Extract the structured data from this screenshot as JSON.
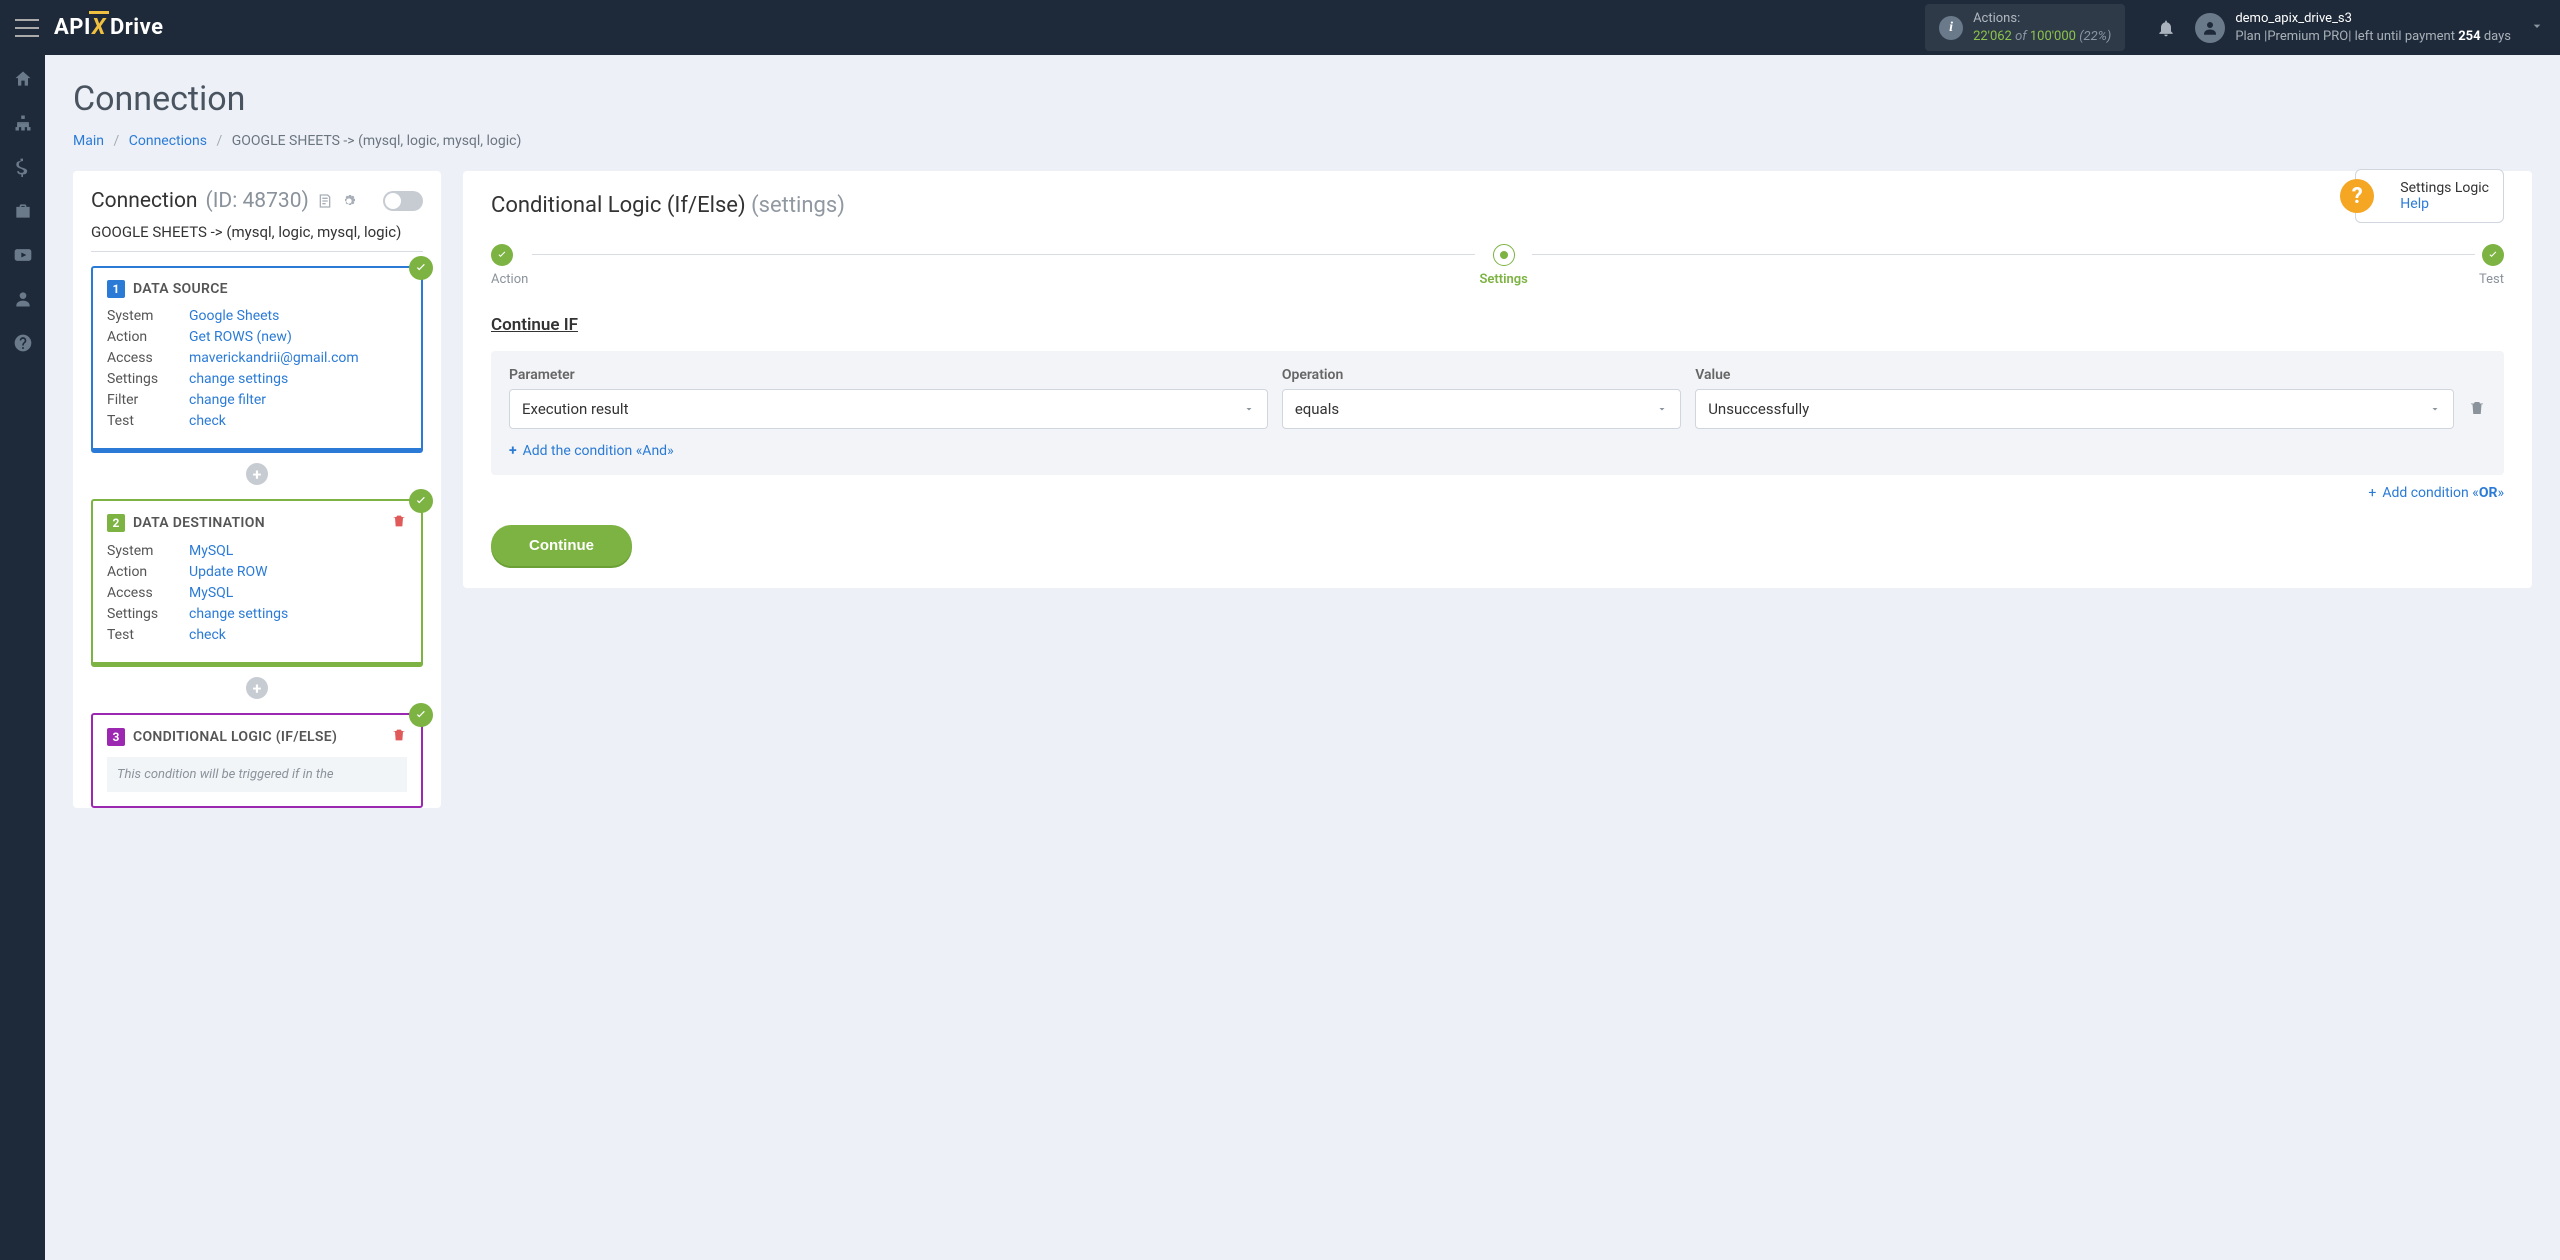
{
  "header": {
    "logo_parts": {
      "api": "API",
      "x": "X",
      "drive": "Drive"
    },
    "actions_label": "Actions:",
    "actions_used": "22'062",
    "actions_of": " of ",
    "actions_total": "100'000",
    "actions_pct": "(22%)",
    "user_name": "demo_apix_drive_s3",
    "plan_prefix": "Plan |",
    "plan_name": "Premium PRO",
    "plan_mid": "| left until payment ",
    "plan_days": "254",
    "plan_suffix": " days"
  },
  "page": {
    "title": "Connection",
    "crumb_main": "Main",
    "crumb_connections": "Connections",
    "crumb_current": "GOOGLE SHEETS -> (mysql, logic, mysql, logic)",
    "help_title": "Settings Logic",
    "help_link": "Help"
  },
  "left": {
    "conn_title": "Connection",
    "conn_id": "(ID: 48730)",
    "conn_sub": "GOOGLE SHEETS -> (mysql, logic, mysql, logic)",
    "block1": {
      "num": "1",
      "title": "DATA SOURCE",
      "rows": [
        {
          "label": "System",
          "val": "Google Sheets"
        },
        {
          "label": "Action",
          "val": "Get ROWS (new)"
        },
        {
          "label": "Access",
          "val": "maverickandrii@gmail.com"
        },
        {
          "label": "Settings",
          "val": "change settings"
        },
        {
          "label": "Filter",
          "val": "change filter"
        },
        {
          "label": "Test",
          "val": "check"
        }
      ]
    },
    "block2": {
      "num": "2",
      "title": "DATA DESTINATION",
      "rows": [
        {
          "label": "System",
          "val": "MySQL"
        },
        {
          "label": "Action",
          "val": "Update ROW"
        },
        {
          "label": "Access",
          "val": "MySQL"
        },
        {
          "label": "Settings",
          "val": "change settings"
        },
        {
          "label": "Test",
          "val": "check"
        }
      ]
    },
    "block3": {
      "num": "3",
      "title": "CONDITIONAL LOGIC (IF/ELSE)",
      "note": "This condition will be triggered if in the"
    }
  },
  "right": {
    "title_main": "Conditional Logic (If/Else)",
    "title_grey": "(settings)",
    "step_action": "Action",
    "step_settings": "Settings",
    "step_test": "Test",
    "section": "Continue IF",
    "col_param": "Parameter",
    "col_op": "Operation",
    "col_val": "Value",
    "sel_param": "Execution result",
    "sel_op": "equals",
    "sel_val": "Unsuccessfully",
    "add_and": "Add the condition «And»",
    "add_or": "Add condition «OR»",
    "continue": "Continue"
  }
}
